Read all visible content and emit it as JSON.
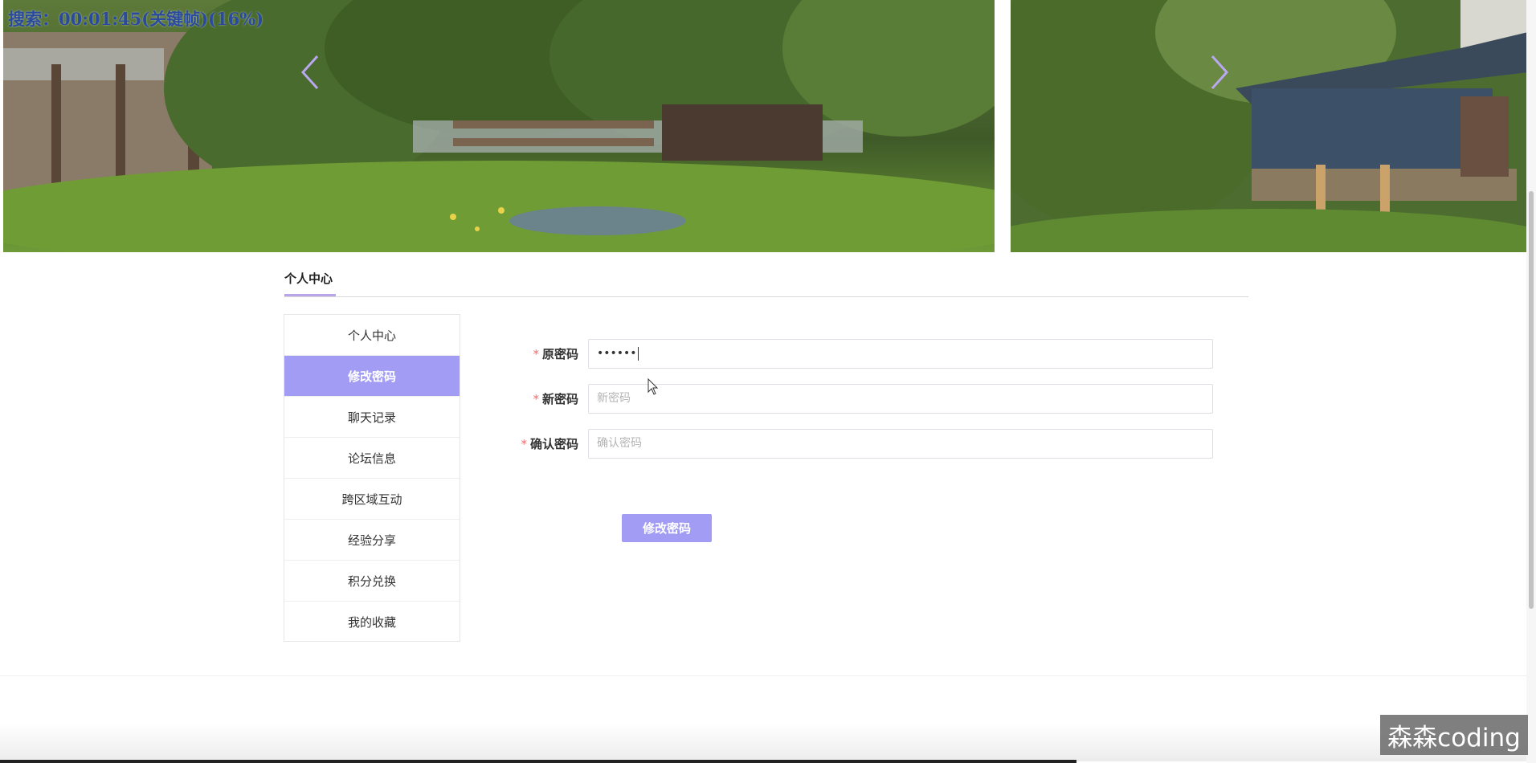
{
  "overlay": {
    "search_status": "搜索：00:01:45(关键帧)(16%)"
  },
  "carousel": {
    "prev_icon": "chevron-left-icon",
    "next_icon": "chevron-right-icon",
    "arrow_color": "#b9a8f0"
  },
  "section": {
    "title": "个人中心"
  },
  "sidebar": {
    "items": [
      {
        "label": "个人中心",
        "active": false
      },
      {
        "label": "修改密码",
        "active": true
      },
      {
        "label": "聊天记录",
        "active": false
      },
      {
        "label": "论坛信息",
        "active": false
      },
      {
        "label": "跨区域互动",
        "active": false
      },
      {
        "label": "经验分享",
        "active": false
      },
      {
        "label": "积分兑换",
        "active": false
      },
      {
        "label": "我的收藏",
        "active": false
      }
    ]
  },
  "form": {
    "required_mark": "*",
    "old_password": {
      "label": "原密码",
      "value": "••••••"
    },
    "new_password": {
      "label": "新密码",
      "placeholder": "新密码",
      "value": ""
    },
    "confirm_password": {
      "label": "确认密码",
      "placeholder": "确认密码",
      "value": ""
    },
    "submit_label": "修改密码"
  },
  "watermark": {
    "text": "森森coding"
  },
  "colors": {
    "accent": "#a29cf4",
    "required": "#f56c6c",
    "search_overlay": "#2a4a9e"
  }
}
